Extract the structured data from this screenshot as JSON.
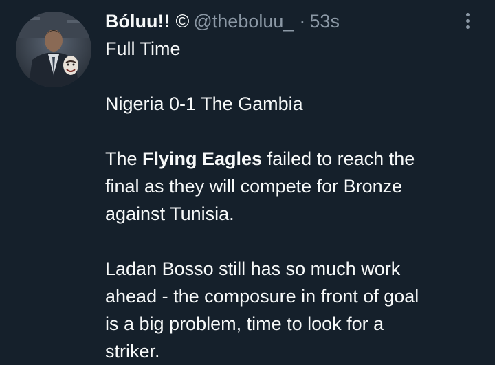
{
  "tweet": {
    "display_name": "Bóluu!!",
    "badge": "©",
    "handle": "@theboluu_",
    "separator": "·",
    "time": "53s",
    "lines": {
      "l1": "Full  Time",
      "l2": "Nigeria 0-1 The Gambia",
      "l3_before": "The ",
      "l3_bold": "Flying Eagles",
      "l3_after": " failed to reach the",
      "l4": "final as they will compete for Bronze",
      "l5": "against Tunisia.",
      "l6": "Ladan Bosso still has so much work",
      "l7": "ahead - the composure in front of goal",
      "l8": "is a big problem, time to look for a",
      "l9": "striker."
    }
  },
  "icons": {
    "more": "more-vertical-icon",
    "avatar": "profile-avatar"
  },
  "colors": {
    "background": "#15202b",
    "text": "#f7f9f9",
    "muted": "#8b98a5"
  }
}
